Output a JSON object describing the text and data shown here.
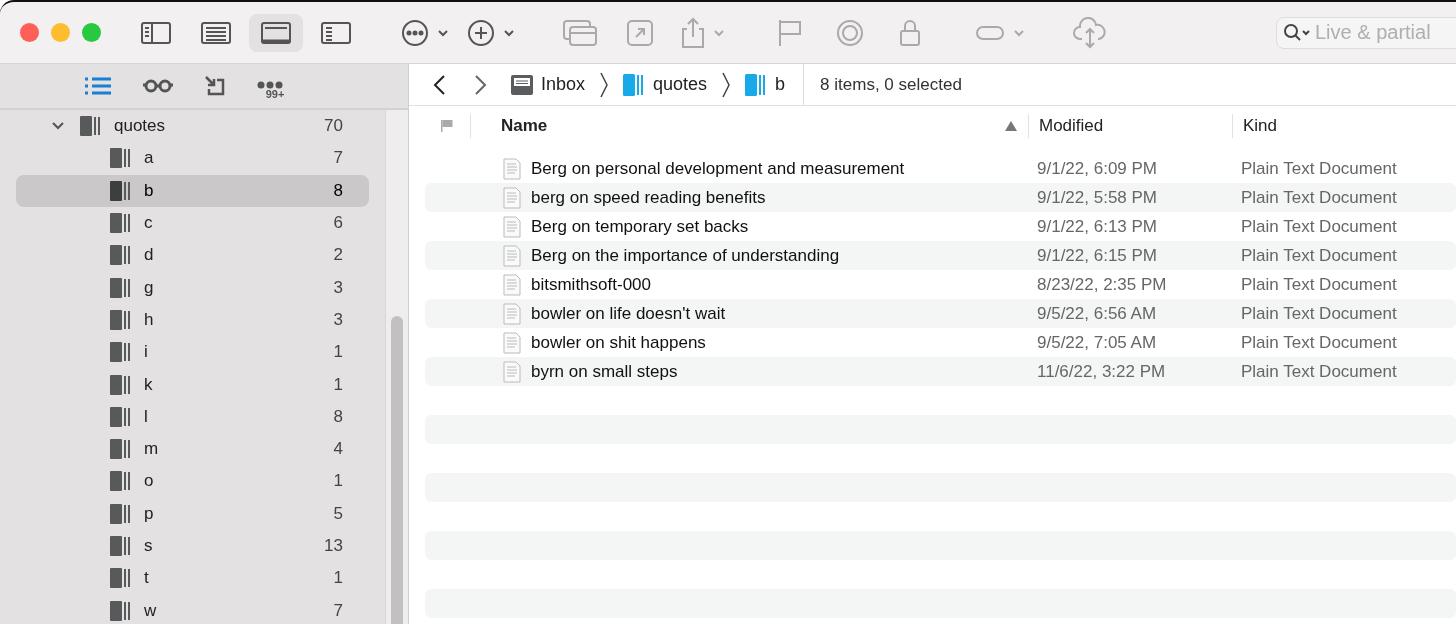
{
  "toolbar": {
    "view_buttons": [
      {
        "selected": false
      },
      {
        "selected": false
      },
      {
        "selected": true
      },
      {
        "selected": false
      }
    ],
    "search": {
      "placeholder": "Live & partial"
    }
  },
  "sidebar": {
    "tabs": [
      {
        "selected": true
      },
      {
        "selected": false
      },
      {
        "selected": false
      },
      {
        "selected": false,
        "badge": "99+"
      }
    ],
    "tree": [
      {
        "name": "quotes",
        "count": "70",
        "expanded": true,
        "selected": false,
        "children": [
          {
            "name": "a",
            "count": "7",
            "selected": false
          },
          {
            "name": "b",
            "count": "8",
            "selected": true
          },
          {
            "name": "c",
            "count": "6",
            "selected": false
          },
          {
            "name": "d",
            "count": "2",
            "selected": false
          },
          {
            "name": "g",
            "count": "3",
            "selected": false
          },
          {
            "name": "h",
            "count": "3",
            "selected": false
          },
          {
            "name": "i",
            "count": "1",
            "selected": false
          },
          {
            "name": "k",
            "count": "1",
            "selected": false
          },
          {
            "name": "l",
            "count": "8",
            "selected": false
          },
          {
            "name": "m",
            "count": "4",
            "selected": false
          },
          {
            "name": "o",
            "count": "1",
            "selected": false
          },
          {
            "name": "p",
            "count": "5",
            "selected": false
          },
          {
            "name": "s",
            "count": "13",
            "selected": false
          },
          {
            "name": "t",
            "count": "1",
            "selected": false
          },
          {
            "name": "w",
            "count": "7",
            "selected": false
          }
        ]
      }
    ]
  },
  "path_bar": {
    "breadcrumbs": [
      {
        "label": "Inbox",
        "kind": "inbox"
      },
      {
        "label": "quotes",
        "kind": "group"
      },
      {
        "label": "b",
        "kind": "group"
      }
    ],
    "status": "8 items, 0 selected"
  },
  "table": {
    "columns": [
      {
        "label": "Name",
        "sorted": true
      },
      {
        "label": "Modified",
        "sorted": false
      },
      {
        "label": "Kind",
        "sorted": false
      }
    ],
    "rows": [
      {
        "name": "Berg on personal development and measurement",
        "modified": "9/1/22, 6:09 PM",
        "kind": "Plain Text Document"
      },
      {
        "name": "berg on speed reading benefits",
        "modified": "9/1/22, 5:58 PM",
        "kind": "Plain Text Document"
      },
      {
        "name": "Berg on temporary set backs",
        "modified": "9/1/22, 6:13 PM",
        "kind": "Plain Text Document"
      },
      {
        "name": "Berg on the importance of understanding",
        "modified": "9/1/22, 6:15 PM",
        "kind": "Plain Text Document"
      },
      {
        "name": "bitsmithsoft-000",
        "modified": "8/23/22, 2:35 PM",
        "kind": "Plain Text Document"
      },
      {
        "name": "bowler on life doesn't wait",
        "modified": "9/5/22, 6:56 AM",
        "kind": "Plain Text Document"
      },
      {
        "name": "bowler on shit happens",
        "modified": "9/5/22, 7:05 AM",
        "kind": "Plain Text Document"
      },
      {
        "name": "byrn on small steps",
        "modified": "11/6/22, 3:22 PM",
        "kind": "Plain Text Document"
      }
    ]
  }
}
